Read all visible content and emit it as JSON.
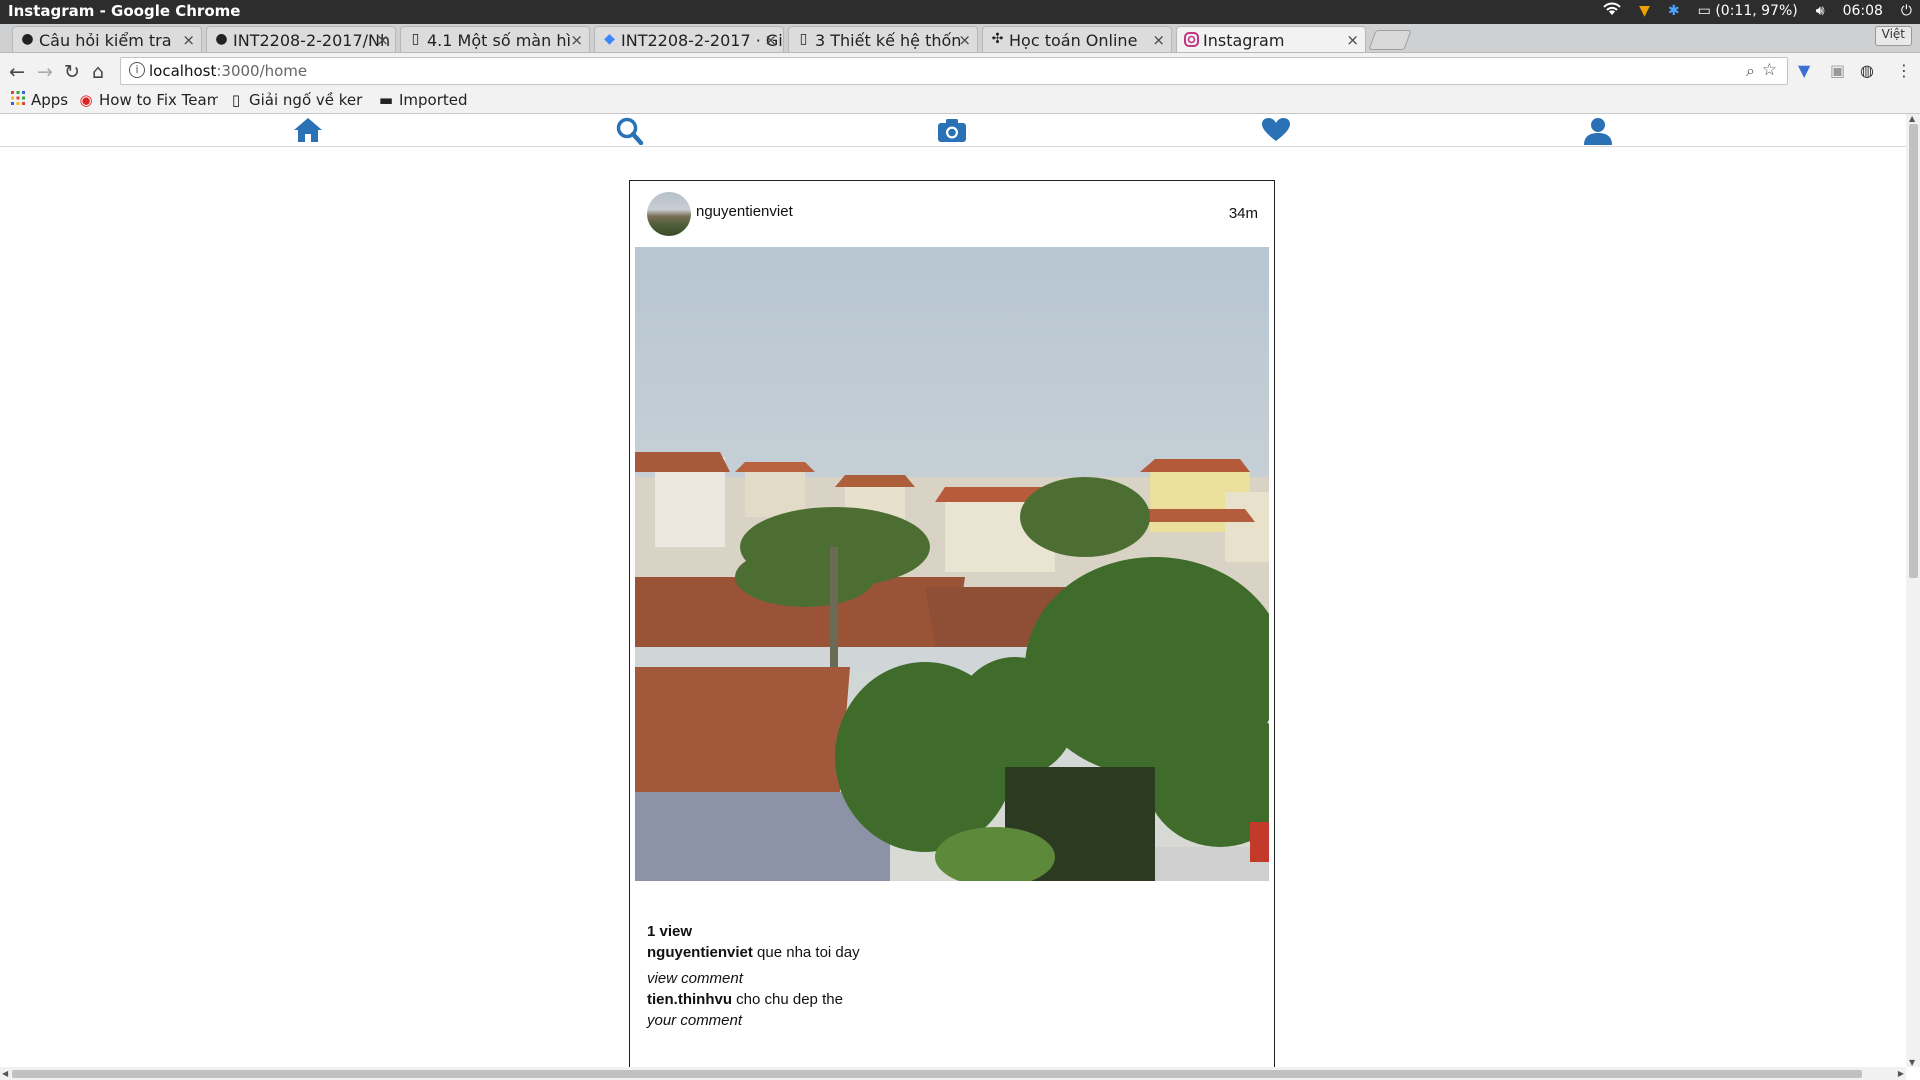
{
  "window": {
    "title": "Instagram - Google Chrome",
    "tray": {
      "battery": "(0:11, 97%)",
      "clock": "06:08"
    }
  },
  "tabs": [
    {
      "label": "Câu hỏi kiểm tra",
      "icon": "github-icon"
    },
    {
      "label": "INT2208-2-2017/Nh",
      "icon": "github-icon"
    },
    {
      "label": "4.1 Một số màn hì",
      "icon": "book-icon"
    },
    {
      "label": "INT2208-2-2017 · Gi",
      "icon": "gitbook-icon"
    },
    {
      "label": "3 Thiết kế hệ thốn",
      "icon": "book-icon"
    },
    {
      "label": "Học toán Online",
      "icon": "puzzle-icon"
    },
    {
      "label": "Instagram",
      "icon": "instagram-icon"
    }
  ],
  "profile_tag": "Việt",
  "address": {
    "host": "localhost",
    "path": ":3000/home"
  },
  "bookmarks": [
    {
      "label": "Apps",
      "icon": "apps-grid-icon"
    },
    {
      "label": "How to Fix Team",
      "icon": "red-logo-icon"
    },
    {
      "label": "Giải ngố về ker",
      "icon": "page-icon"
    },
    {
      "label": "Imported",
      "icon": "folder-icon"
    }
  ],
  "app_nav": {
    "color": "#2a72b5",
    "items": [
      "home-icon",
      "search-icon",
      "camera-icon",
      "heart-icon",
      "profile-icon"
    ]
  },
  "post": {
    "author": "nguyentienviet",
    "time_ago": "34m",
    "views": "1 view",
    "caption_user": "nguyentienviet",
    "caption_text": "que nha toi day",
    "view_comment_label": "view comment",
    "comment_user": "tien.thinhvu",
    "comment_text": "cho chu dep the",
    "your_comment_placeholder": "your comment"
  }
}
